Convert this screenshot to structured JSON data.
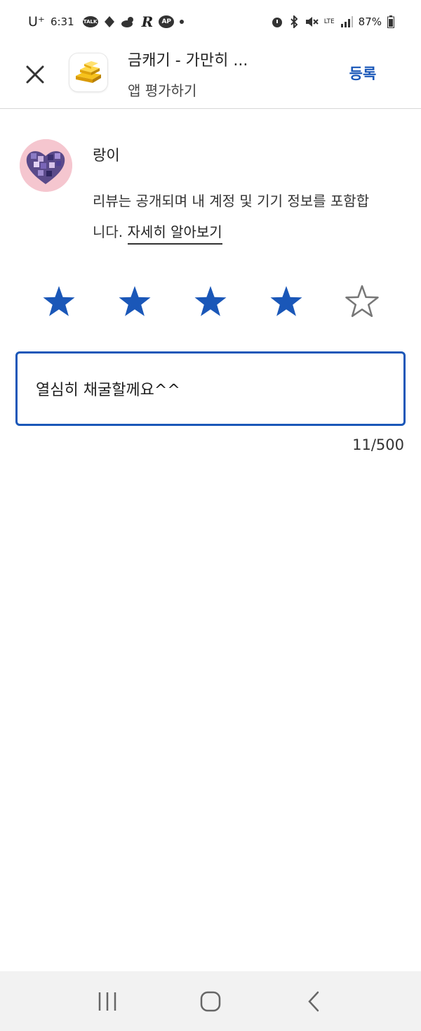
{
  "status_bar": {
    "carrier": "U⁺",
    "time": "6:31",
    "talk_badge": "TALK",
    "r_icon": "R",
    "ap_badge": "AP",
    "network": "LTE",
    "battery_percent": "87%",
    "icons": [
      "kakaotalk-icon",
      "drop-icon",
      "weather-icon",
      "r-app-icon",
      "ap-icon",
      "dot-icon",
      "alarm-icon",
      "bluetooth-icon",
      "mute-icon",
      "lte-icon",
      "signal-icon",
      "battery-icon"
    ]
  },
  "header": {
    "app_title": "금캐기 - 가만히 ...",
    "subtitle": "앱 평가하기",
    "post_label": "등록",
    "app_icon": "gold-bars-icon"
  },
  "user": {
    "name": "랑이",
    "notice_text": "리뷰는 공개되며 내 계정 및 기기 정보를 포함합니다. ",
    "learn_more": "자세히 알아보기"
  },
  "rating": {
    "value": 4,
    "max": 5,
    "filled_color": "#1a57b8",
    "empty_color": "#777777"
  },
  "review": {
    "text": "열심히 채굴할께요^^",
    "counter": "11/500"
  },
  "colors": {
    "accent": "#1a57b8"
  }
}
